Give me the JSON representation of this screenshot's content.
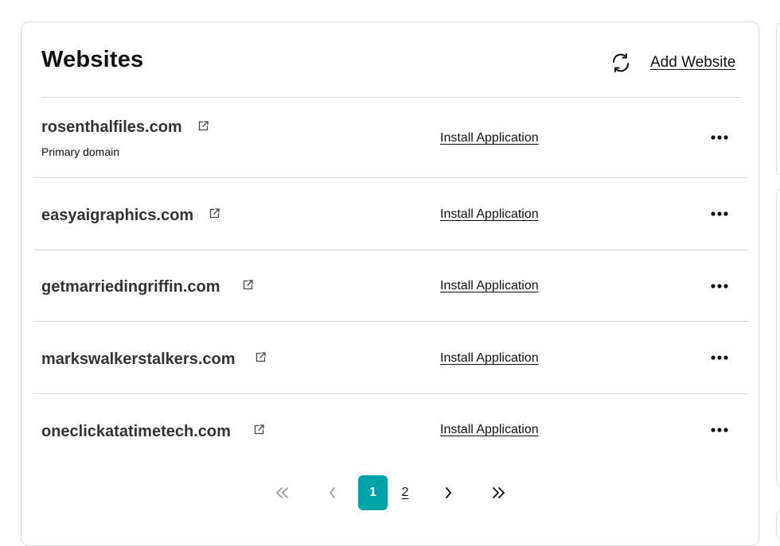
{
  "header": {
    "title": "Websites",
    "add_website_label": "Add Website",
    "refresh_icon": "refresh-icon"
  },
  "sites": [
    {
      "domain": "rosenthalfiles.com",
      "subtitle": "Primary domain",
      "action": "Install Application"
    },
    {
      "domain": "easyaigraphics.com",
      "action": "Install Application"
    },
    {
      "domain": "getmarriedingriffin.com",
      "action": "Install Application"
    },
    {
      "domain": "markswalkerstalkers.com",
      "action": "Install Application"
    },
    {
      "domain": "oneclickatatimetech.com",
      "action": "Install Application"
    }
  ],
  "pagination": {
    "pages": [
      "1",
      "2"
    ],
    "current": "1",
    "icons": [
      "first-page-icon",
      "previous-page-icon",
      "next-page-icon",
      "last-page-icon"
    ]
  },
  "colors": {
    "accent": "#00a4a6",
    "text": "#111111",
    "domain_text": "#333333",
    "border": "#d9d9d9"
  }
}
